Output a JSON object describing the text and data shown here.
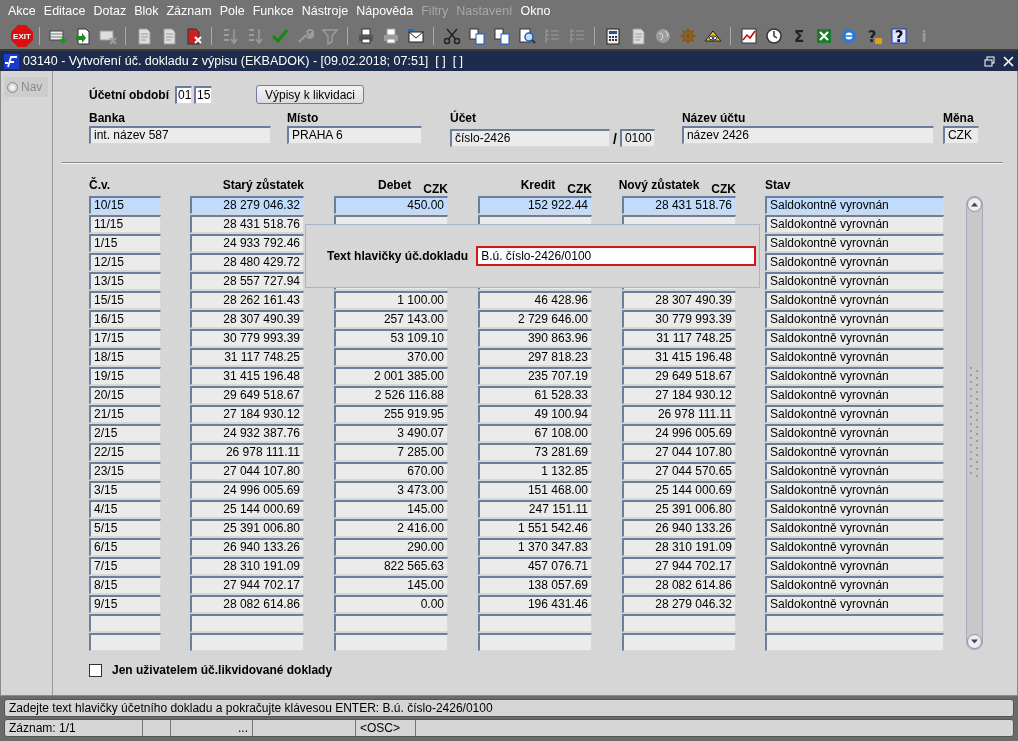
{
  "menu": [
    {
      "label": "Akce",
      "disabled": false
    },
    {
      "label": "Editace",
      "disabled": false
    },
    {
      "label": "Dotaz",
      "disabled": false
    },
    {
      "label": "Blok",
      "disabled": false
    },
    {
      "label": "Záznam",
      "disabled": false
    },
    {
      "label": "Pole",
      "disabled": false
    },
    {
      "label": "Funkce",
      "disabled": false
    },
    {
      "label": "Nástroje",
      "disabled": false
    },
    {
      "label": "Nápověda",
      "disabled": false
    },
    {
      "label": "Filtry",
      "disabled": true
    },
    {
      "label": "Nastavení",
      "disabled": true
    },
    {
      "label": "Okno",
      "disabled": false
    }
  ],
  "toolbar": [
    {
      "kind": "exit",
      "label": "EXIT",
      "disabled": false
    },
    {
      "kind": "separator"
    },
    {
      "kind": "table-plus",
      "disabled": false
    },
    {
      "kind": "document-plus",
      "disabled": false
    },
    {
      "kind": "table-delete",
      "disabled": true
    },
    {
      "kind": "separator"
    },
    {
      "kind": "document-question",
      "disabled": true
    },
    {
      "kind": "document-arrow",
      "disabled": true
    },
    {
      "kind": "document-delete",
      "disabled": false
    },
    {
      "kind": "separator"
    },
    {
      "kind": "sort-ascending",
      "disabled": true
    },
    {
      "kind": "sort-descending",
      "disabled": true
    },
    {
      "kind": "checkmark",
      "disabled": false
    },
    {
      "kind": "wrench",
      "disabled": true
    },
    {
      "kind": "filter",
      "disabled": true
    },
    {
      "kind": "separator"
    },
    {
      "kind": "printer",
      "disabled": false
    },
    {
      "kind": "printer-stack",
      "disabled": true
    },
    {
      "kind": "envelope",
      "disabled": false
    },
    {
      "kind": "separator"
    },
    {
      "kind": "scissors",
      "disabled": false
    },
    {
      "kind": "document-copy",
      "disabled": false
    },
    {
      "kind": "document-paste",
      "disabled": false
    },
    {
      "kind": "magnifier",
      "disabled": false
    },
    {
      "kind": "list",
      "disabled": true
    },
    {
      "kind": "list-tree",
      "disabled": true
    },
    {
      "kind": "separator"
    },
    {
      "kind": "calculator",
      "disabled": false
    },
    {
      "kind": "document",
      "disabled": true
    },
    {
      "kind": "globe",
      "disabled": true
    },
    {
      "kind": "ship-wheel",
      "disabled": false
    },
    {
      "kind": "eye",
      "disabled": false
    },
    {
      "kind": "separator"
    },
    {
      "kind": "chart",
      "disabled": false
    },
    {
      "kind": "clock",
      "disabled": false
    },
    {
      "kind": "sigma",
      "label": "Σ",
      "disabled": false
    },
    {
      "kind": "spreadsheet",
      "disabled": false
    },
    {
      "kind": "browser",
      "disabled": false
    },
    {
      "kind": "help-lock",
      "label": "?",
      "disabled": false
    },
    {
      "kind": "help",
      "label": "?",
      "disabled": false
    },
    {
      "kind": "info",
      "label": "i",
      "disabled": true
    }
  ],
  "window": {
    "title": "03140 - Vytvoření úč. dokladu z výpisu (EKBADOK) - [09.02.2018; 07:51]  [ ]  [ ]"
  },
  "nav": {
    "label": "Nav",
    "selected": false
  },
  "period": {
    "label": "Účetní období",
    "month": "01",
    "year": "15"
  },
  "statements_button": "Výpisy k likvidaci",
  "header_fields": [
    {
      "label": "Banka",
      "value": "int. název 587"
    },
    {
      "label": "Místo",
      "value": "PRAHA 6"
    },
    {
      "label": "Účet",
      "value": "číslo-2426",
      "separator": "/",
      "code": "0100"
    },
    {
      "label": "Název účtu",
      "value": "název 2426"
    },
    {
      "label": "Měna",
      "value": "CZK"
    }
  ],
  "table": {
    "columns": [
      {
        "label": "Č.v.",
        "numeric": false
      },
      {
        "label": "Starý zůstatek",
        "numeric": true
      },
      {
        "label": "Debet",
        "numeric": true,
        "unit": "CZK"
      },
      {
        "label": "Kredit",
        "numeric": true,
        "unit": "CZK"
      },
      {
        "label": "Nový zůstatek",
        "numeric": true,
        "unit": "CZK"
      },
      {
        "label": "Stav",
        "numeric": false
      }
    ],
    "rows": [
      {
        "selected": true,
        "cells": [
          "10/15",
          "28 279 046.32",
          "450.00",
          "152 922.44",
          "28 431 518.76",
          "Saldokontně vyrovnán"
        ]
      },
      {
        "selected": false,
        "cells": [
          "11/15",
          "28 431 518.76",
          null,
          null,
          null,
          "Saldokontně vyrovnán"
        ]
      },
      {
        "selected": false,
        "cells": [
          "1/15",
          "24 933 792.46",
          null,
          null,
          null,
          "Saldokontně vyrovnán"
        ]
      },
      {
        "selected": false,
        "cells": [
          "12/15",
          "28 480 429.72",
          null,
          null,
          null,
          "Saldokontně vyrovnán"
        ]
      },
      {
        "selected": false,
        "cells": [
          "13/15",
          "28 557 727.94",
          null,
          null,
          null,
          "Saldokontně vyrovnán"
        ]
      },
      {
        "selected": false,
        "cells": [
          "15/15",
          "28 262 161.43",
          "1 100.00",
          "46 428.96",
          "28 307 490.39",
          "Saldokontně vyrovnán"
        ]
      },
      {
        "selected": false,
        "cells": [
          "16/15",
          "28 307 490.39",
          "257 143.00",
          "2 729 646.00",
          "30 779 993.39",
          "Saldokontně vyrovnán"
        ]
      },
      {
        "selected": false,
        "cells": [
          "17/15",
          "30 779 993.39",
          "53 109.10",
          "390 863.96",
          "31 117 748.25",
          "Saldokontně vyrovnán"
        ]
      },
      {
        "selected": false,
        "cells": [
          "18/15",
          "31 117 748.25",
          "370.00",
          "297 818.23",
          "31 415 196.48",
          "Saldokontně vyrovnán"
        ]
      },
      {
        "selected": false,
        "cells": [
          "19/15",
          "31 415 196.48",
          "2 001 385.00",
          "235 707.19",
          "29 649 518.67",
          "Saldokontně vyrovnán"
        ]
      },
      {
        "selected": false,
        "cells": [
          "20/15",
          "29 649 518.67",
          "2 526 116.88",
          "61 528.33",
          "27 184 930.12",
          "Saldokontně vyrovnán"
        ]
      },
      {
        "selected": false,
        "cells": [
          "21/15",
          "27 184 930.12",
          "255 919.95",
          "49 100.94",
          "26 978 111.11",
          "Saldokontně vyrovnán"
        ]
      },
      {
        "selected": false,
        "cells": [
          "2/15",
          "24 932 387.76",
          "3 490.07",
          "67 108.00",
          "24 996 005.69",
          "Saldokontně vyrovnán"
        ]
      },
      {
        "selected": false,
        "cells": [
          "22/15",
          "26 978 111.11",
          "7 285.00",
          "73 281.69",
          "27 044 107.80",
          "Saldokontně vyrovnán"
        ]
      },
      {
        "selected": false,
        "cells": [
          "23/15",
          "27 044 107.80",
          "670.00",
          "1 132.85",
          "27 044 570.65",
          "Saldokontně vyrovnán"
        ]
      },
      {
        "selected": false,
        "cells": [
          "3/15",
          "24 996 005.69",
          "3 473.00",
          "151 468.00",
          "25 144 000.69",
          "Saldokontně vyrovnán"
        ]
      },
      {
        "selected": false,
        "cells": [
          "4/15",
          "25 144 000.69",
          "145.00",
          "247 151.11",
          "25 391 006.80",
          "Saldokontně vyrovnán"
        ]
      },
      {
        "selected": false,
        "cells": [
          "5/15",
          "25 391 006.80",
          "2 416.00",
          "1 551 542.46",
          "26 940 133.26",
          "Saldokontně vyrovnán"
        ]
      },
      {
        "selected": false,
        "cells": [
          "6/15",
          "26 940 133.26",
          "290.00",
          "1 370 347.83",
          "28 310 191.09",
          "Saldokontně vyrovnán"
        ]
      },
      {
        "selected": false,
        "cells": [
          "7/15",
          "28 310 191.09",
          "822 565.63",
          "457 076.71",
          "27 944 702.17",
          "Saldokontně vyrovnán"
        ]
      },
      {
        "selected": false,
        "cells": [
          "8/15",
          "27 944 702.17",
          "145.00",
          "138 057.69",
          "28 082 614.86",
          "Saldokontně vyrovnán"
        ]
      },
      {
        "selected": false,
        "cells": [
          "9/15",
          "28 082 614.86",
          "0.00",
          "196 431.46",
          "28 279 046.32",
          "Saldokontně vyrovnán"
        ]
      },
      {
        "selected": false,
        "cells": [
          null,
          null,
          null,
          null,
          null,
          null
        ]
      },
      {
        "selected": false,
        "cells": [
          null,
          null,
          null,
          null,
          null,
          null
        ]
      }
    ]
  },
  "dialog": {
    "label": "Text hlavičky úč.dokladu",
    "value": "B.ú. číslo-2426/0100",
    "focused": true
  },
  "filter_checkbox": {
    "label": "Jen uživatelem úč.likvidované doklady",
    "checked": false
  },
  "status_bar": {
    "message": "Zadejte text hlavičky účetního dokladu a pokračujte klávesou ENTER: B.ú. číslo-2426/0100",
    "cells": [
      {
        "text": "Záznam: 1/1"
      },
      {},
      {
        "text": "...",
        "right_aligned": true
      },
      {},
      {
        "text": "<OSC>"
      }
    ]
  }
}
